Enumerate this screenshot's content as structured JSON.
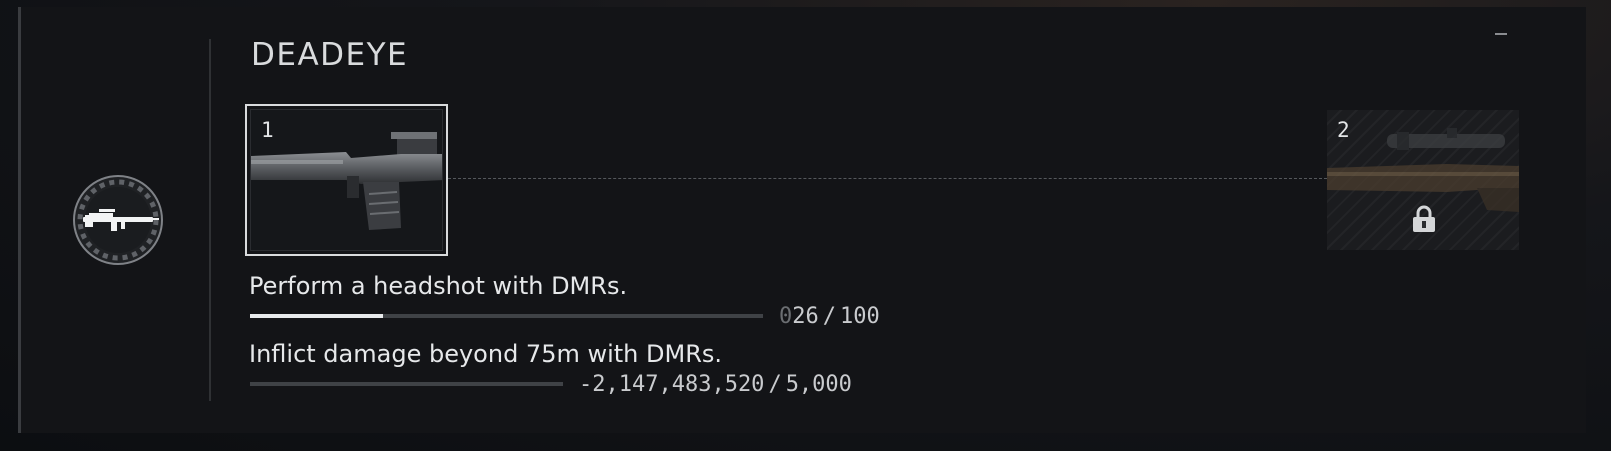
{
  "mastery": {
    "title": "DEADEYE",
    "badge_icon": "rifle-badge-icon",
    "tiers": [
      {
        "number": "1",
        "state": "unlocked",
        "icon": "dmr-rifle-image"
      },
      {
        "number": "2",
        "state": "locked",
        "icon": "sniper-rifle-image"
      }
    ],
    "challenges": [
      {
        "description": "Perform a headshot with DMRs.",
        "progress_leading": "0",
        "progress_current": "26",
        "progress_separator": "/",
        "progress_target": "100",
        "progress_fraction": 0.26
      },
      {
        "description": "Inflict damage beyond 75m with DMRs.",
        "progress_leading": "",
        "progress_current": "-2,147,483,520",
        "progress_separator": "/",
        "progress_target": "5,000",
        "progress_fraction": 0.0
      }
    ]
  },
  "colors": {
    "panel_bg": "#131417",
    "accent_white": "#e8eaec",
    "bar_track": "#3f4246",
    "locked_hatch": "#232427"
  }
}
